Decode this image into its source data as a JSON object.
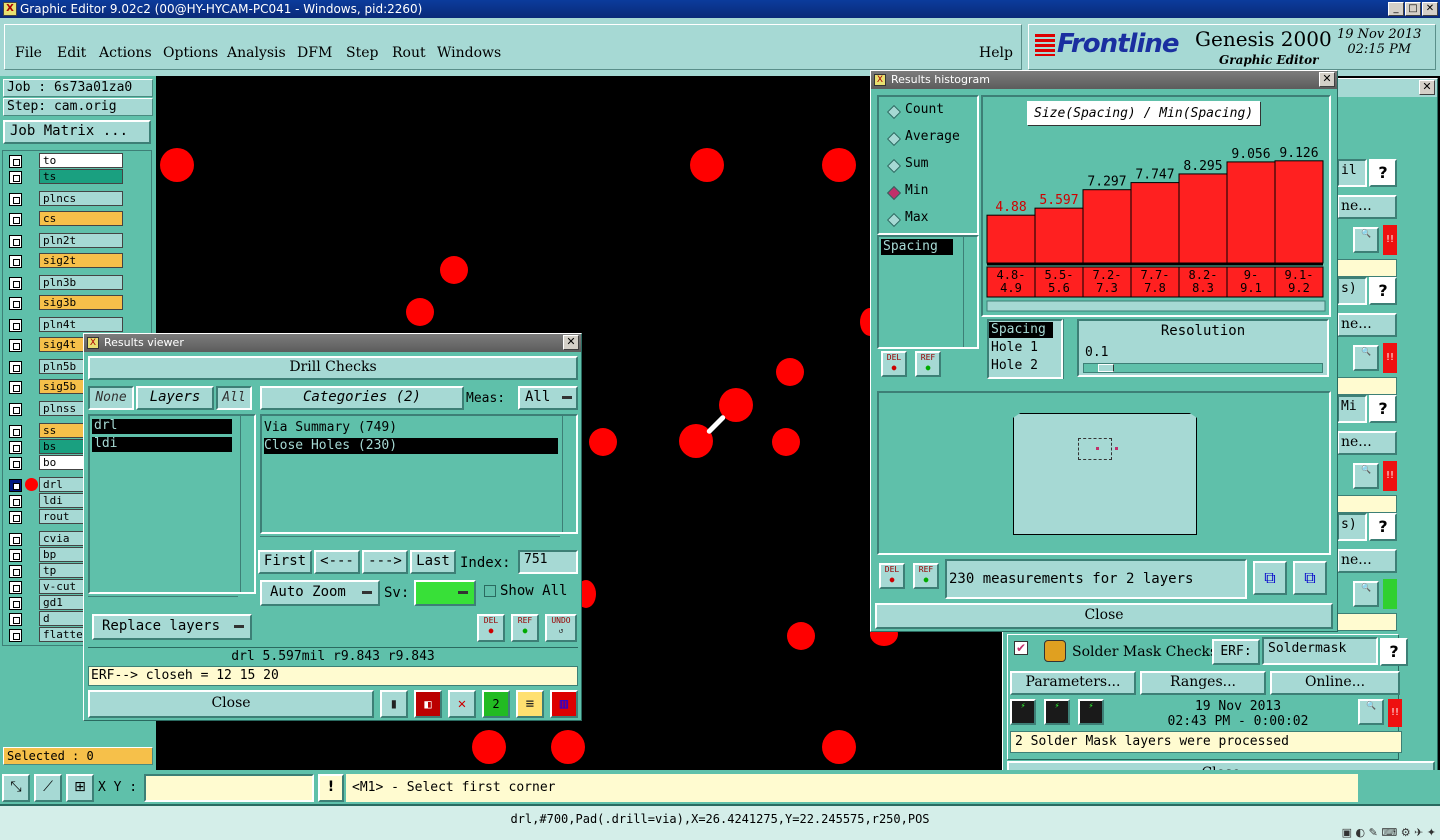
{
  "window": {
    "title": "Graphic Editor 9.02c2 (00@HY-HYCAM-PC041 - Windows, pid:2260)",
    "icon_text": "X"
  },
  "menu": {
    "items": [
      "File",
      "Edit",
      "Actions",
      "Options",
      "Analysis",
      "DFM",
      "Step",
      "Rout",
      "Windows"
    ],
    "help": "Help"
  },
  "branding": {
    "logo": "Frontline",
    "product": "Genesis 2000",
    "subtitle": "Graphic Editor",
    "date": "19 Nov 2013",
    "time": "02:15 PM"
  },
  "left": {
    "job": "Job : 6s73a01za0",
    "step": "Step: cam.orig",
    "job_matrix": "Job Matrix ...",
    "layers": [
      {
        "name": "to",
        "style": "lw"
      },
      {
        "name": "ts",
        "style": "lt"
      },
      {
        "name": "plncs",
        "style": "lg"
      },
      {
        "name": "cs",
        "style": "ly"
      },
      {
        "name": "pln2t",
        "style": "lg"
      },
      {
        "name": "sig2t",
        "style": "ly"
      },
      {
        "name": "pln3b",
        "style": "lg"
      },
      {
        "name": "sig3b",
        "style": "ly"
      },
      {
        "name": "pln4t",
        "style": "lg"
      },
      {
        "name": "sig4t",
        "style": "ly"
      },
      {
        "name": "pln5b",
        "style": "lg"
      },
      {
        "name": "sig5b",
        "style": "ly"
      },
      {
        "name": "plnss",
        "style": "lg"
      },
      {
        "name": "ss",
        "style": "ly"
      },
      {
        "name": "bs",
        "style": "lt"
      },
      {
        "name": "bo",
        "style": "lw"
      },
      {
        "name": "drl",
        "style": "lg"
      },
      {
        "name": "ldi",
        "style": "lg"
      },
      {
        "name": "rout",
        "style": "lg"
      },
      {
        "name": "cvia",
        "style": "lg"
      },
      {
        "name": "bp",
        "style": "lg"
      },
      {
        "name": "tp",
        "style": "lg"
      },
      {
        "name": "v-cut",
        "style": "lg"
      },
      {
        "name": "gd1",
        "style": "lg"
      },
      {
        "name": "d",
        "style": "lg"
      },
      {
        "name": "flatte",
        "style": "lg"
      }
    ],
    "selected": "Selected : 0"
  },
  "results_viewer": {
    "title": "Results viewer",
    "header": "Drill Checks",
    "none": "None",
    "layers": "Layers",
    "all": "All",
    "categories": "Categories (2)",
    "meas_label": "Meas:",
    "meas_value": "All",
    "layer_list": [
      "drl",
      "ldi"
    ],
    "category_list": [
      "Via Summary (749)",
      "Close Holes (230)"
    ],
    "first": "First",
    "prev": "<---",
    "next": "--->",
    "last": "Last",
    "index_label": "Index:",
    "index_value": "751",
    "auto_zoom": "Auto Zoom",
    "sv_label": "Sv:",
    "show_all": "Show All",
    "replace_layers": "Replace layers",
    "measurement": "drl  5.597mil  r9.843  r9.843",
    "erf": "ERF--> closeh = 12 15 20",
    "close": "Close",
    "icon_del": "DEL",
    "icon_ref": "REF",
    "icon_undo": "UNDO"
  },
  "histogram": {
    "title": "Results histogram",
    "modes": [
      "Count",
      "Average",
      "Sum",
      "Min",
      "Max"
    ],
    "selected_mode": "Min",
    "list_item": "Spacing",
    "chart_title": "Size(Spacing) / Min(Spacing)",
    "resolution_label": "Resolution",
    "resolution_value": "0.1",
    "fields": [
      "Spacing",
      "Hole 1",
      "Hole 2"
    ],
    "summary": "230 measurements for 2 layers",
    "close": "Close"
  },
  "chart_data": {
    "type": "bar",
    "title": "Size(Spacing) / Min(Spacing)",
    "categories": [
      "4.8-4.9",
      "5.5-5.6",
      "7.2-7.3",
      "7.7-7.8",
      "8.2-8.3",
      "9-9.1",
      "9.1-9.2"
    ],
    "category_lines": [
      [
        "4.8-",
        "4.9"
      ],
      [
        "5.5-",
        "5.6"
      ],
      [
        "7.2-",
        "7.3"
      ],
      [
        "7.7-",
        "7.8"
      ],
      [
        "8.2-",
        "8.3"
      ],
      [
        "9-",
        "9.1"
      ],
      [
        "9.1-",
        "9.2"
      ]
    ],
    "values": [
      4.88,
      5.597,
      7.297,
      7.747,
      8.295,
      9.056,
      9.126
    ],
    "labels": [
      "4.88",
      "5.597",
      "7.297",
      "7.747",
      "8.295",
      "9.056",
      "9.126"
    ],
    "value_colors": [
      "#d00000",
      "#d00000",
      "#000000",
      "#000000",
      "#000000",
      "#000000",
      "#000000"
    ],
    "ylim": [
      0,
      10
    ]
  },
  "right_panel": {
    "partial_labels": [
      "il",
      "ne...",
      "s)",
      "ne...",
      "Mi",
      "ne...",
      "s)",
      "ne..."
    ],
    "solder": {
      "title": "Solder Mask Checks",
      "erf_label": "ERF:",
      "erf_value": "Soldermask",
      "parameters": "Parameters...",
      "ranges": "Ranges...",
      "online": "Online...",
      "date": "19 Nov 2013",
      "time": "02:43 PM - 0:00:02",
      "message": "2 Solder Mask layers were processed"
    },
    "close": "Close"
  },
  "bottom": {
    "xy_label": "X Y :",
    "xy_value": "",
    "prompt": "<M1> - Select first corner"
  },
  "status": {
    "text": "drl,#700,Pad(.drill=via),X=26.4241275,Y=22.245575,r250,POS"
  },
  "colors": {
    "panel": "#5fc0aa",
    "light": "#a6d9d4",
    "pad": "#ff0000",
    "canvas": "#000000"
  }
}
